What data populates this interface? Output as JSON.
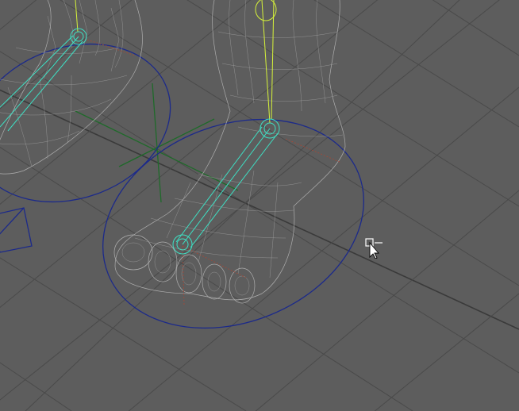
{
  "viewport": {
    "label": "",
    "background_color": "#5d5d5d",
    "grid_color": "#4a4a4a",
    "wireframe_color": "#bcbcbc",
    "control_circle_color": "#1c2a8a",
    "joint_color": "#3ee0c4",
    "bone_highlight_color": "#d6f23a"
  },
  "objects": {
    "left_foot": "left-foot-wireframe",
    "right_foot": "right-foot-wireframe",
    "left_control": "left-foot-control-circle",
    "right_control": "right-foot-control-circle"
  },
  "cursor": {
    "icon": "arrow-with-tool-icon"
  }
}
